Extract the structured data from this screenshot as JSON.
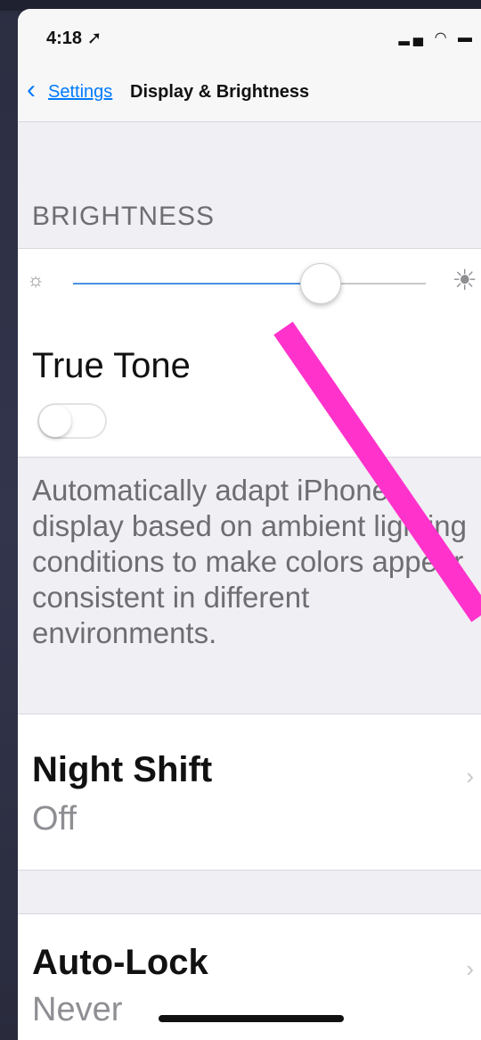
{
  "status_bar": {
    "time": "4:18",
    "location_icon": "location-arrow-icon",
    "icons": [
      "cellular-signal-icon",
      "wifi-icon",
      "battery-icon"
    ]
  },
  "nav": {
    "back_label": "Settings",
    "title": "Display & Brightness"
  },
  "brightness": {
    "section_header": "BRIGHTNESS",
    "level": 0.7,
    "min_icon": "sun-small-icon",
    "max_icon": "sun-large-icon"
  },
  "true_tone": {
    "label": "True Tone",
    "enabled": false,
    "footer": "Automatically adapt iPhone display based on ambient lighting conditions to make colors appear consistent in different environments."
  },
  "night_shift": {
    "title": "Night Shift",
    "value": "Off"
  },
  "auto_lock": {
    "title": "Auto-Lock",
    "value": "Never"
  },
  "colors": {
    "accent": "#007aff",
    "annotation": "#ff33cc"
  }
}
